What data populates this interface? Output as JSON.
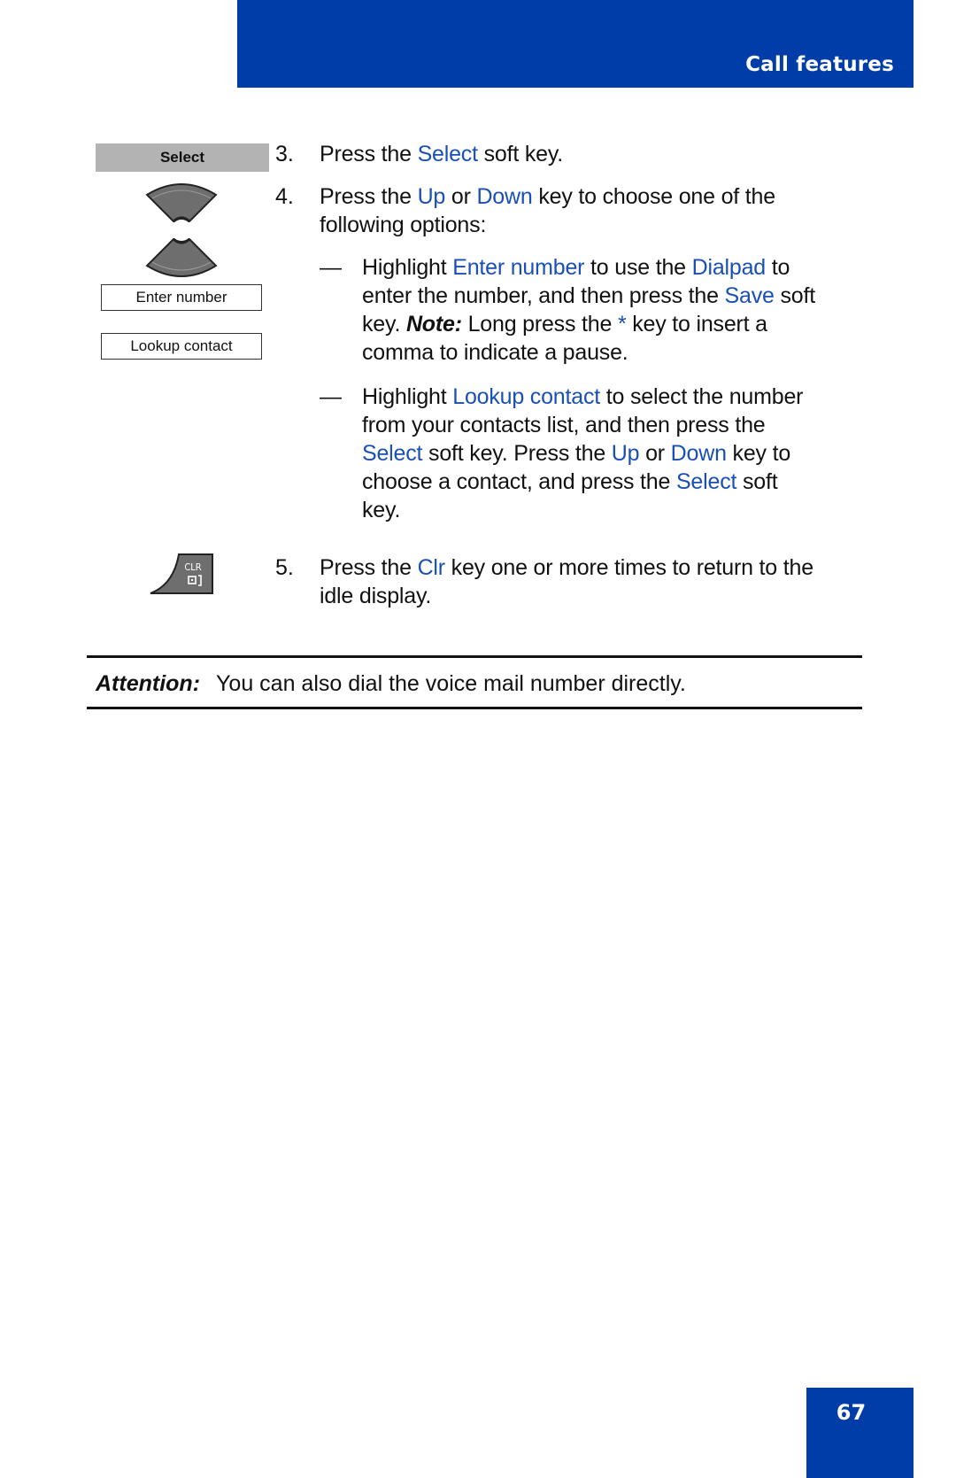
{
  "header": {
    "section_title": "Call features",
    "color": "#003da8"
  },
  "sidebar": {
    "softkey_label": "Select",
    "nav_icon": "up-down-navigation-key-icon",
    "options": [
      "Enter number",
      "Lookup contact"
    ],
    "clr_icon": "clr-key-icon",
    "clr_label": "CLR"
  },
  "steps": [
    {
      "number": "3.",
      "lines": [
        [
          {
            "t": "Press the "
          },
          {
            "t": "Select",
            "k": 1
          },
          {
            "t": " soft key."
          }
        ]
      ]
    },
    {
      "number": "4.",
      "lines": [
        [
          {
            "t": "Press the "
          },
          {
            "t": "Up",
            "k": 1
          },
          {
            "t": " or "
          },
          {
            "t": "Down",
            "k": 1
          },
          {
            "t": " key to choose one of the"
          }
        ],
        [
          {
            "t": "following options:"
          }
        ]
      ],
      "sub": [
        {
          "dash": "—",
          "lines": [
            [
              {
                "t": "Highlight "
              },
              {
                "t": "Enter number",
                "k": 1
              },
              {
                "t": " to use the "
              },
              {
                "t": "Dialpad",
                "k": 1
              },
              {
                "t": " to"
              }
            ],
            [
              {
                "t": "enter the number, and then press the "
              },
              {
                "t": "Save",
                "k": 1
              },
              {
                "t": " soft"
              }
            ],
            [
              {
                "t": "key. "
              },
              {
                "t": "Note:",
                "b": 1
              },
              {
                "t": " Long press the "
              },
              {
                "t": "*",
                "k": 1
              },
              {
                "t": " key to insert a"
              }
            ],
            [
              {
                "t": "comma to indicate a pause."
              }
            ]
          ]
        },
        {
          "dash": "—",
          "lines": [
            [
              {
                "t": "Highlight "
              },
              {
                "t": "Lookup contact",
                "k": 1
              },
              {
                "t": " to select the number"
              }
            ],
            [
              {
                "t": "from your contacts list, and then press the"
              }
            ],
            [
              {
                "t": "Select",
                "k": 1
              },
              {
                "t": " soft key. Press the "
              },
              {
                "t": "Up",
                "k": 1
              },
              {
                "t": " or "
              },
              {
                "t": "Down",
                "k": 1
              },
              {
                "t": " key to"
              }
            ],
            [
              {
                "t": "choose a contact, and press the "
              },
              {
                "t": "Select",
                "k": 1
              },
              {
                "t": " soft"
              }
            ],
            [
              {
                "t": "key."
              }
            ]
          ]
        }
      ]
    },
    {
      "number": "5.",
      "lines": [
        [
          {
            "t": "Press the "
          },
          {
            "t": "Clr",
            "k": 1
          },
          {
            "t": " key one or more times to return to the"
          }
        ],
        [
          {
            "t": "idle display."
          }
        ]
      ]
    }
  ],
  "attention": {
    "label": "Attention:",
    "text": "You can also dial the voice mail number directly."
  },
  "footer": {
    "page_number": "67"
  },
  "colors": {
    "keyword": "#1a4fb5",
    "brand": "#003da8"
  }
}
